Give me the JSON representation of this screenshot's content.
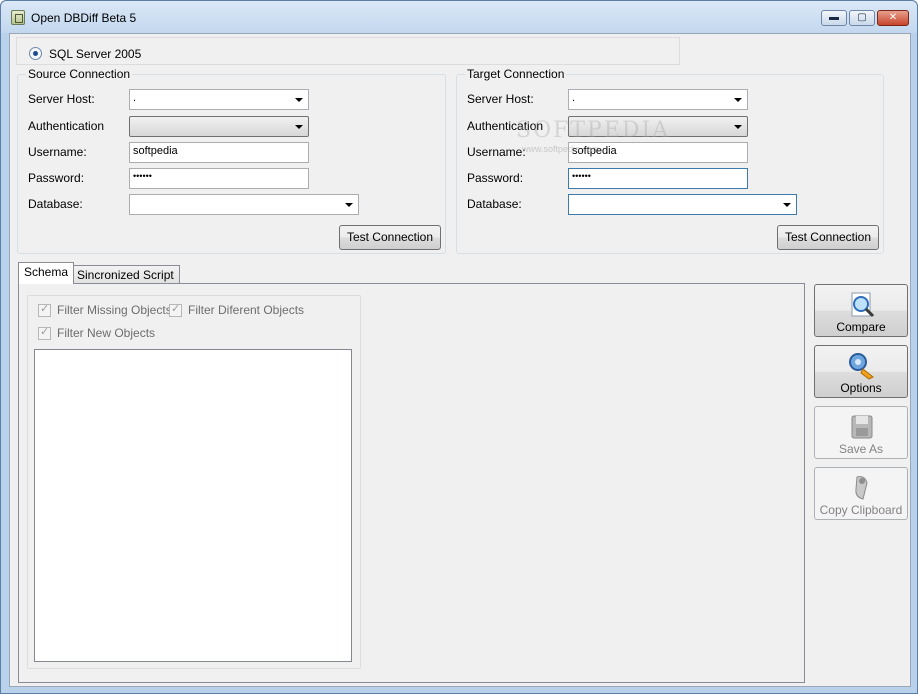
{
  "window": {
    "title": "Open DBDiff Beta 5",
    "controls": {
      "minimize": "▬",
      "maximize": "▢",
      "close": "✕"
    }
  },
  "provider": {
    "label": "SQL Server 2005",
    "selected": true
  },
  "source": {
    "title": "Source Connection",
    "server_host_label": "Server Host:",
    "server_host_value": ".",
    "authentication_label": "Authentication",
    "authentication_value": "",
    "username_label": "Username:",
    "username_value": "softpedia",
    "password_label": "Password:",
    "password_value": "••••••",
    "database_label": "Database:",
    "database_value": "",
    "test_button": "Test Connection"
  },
  "target": {
    "title": "Target Connection",
    "server_host_label": "Server Host:",
    "server_host_value": ".",
    "authentication_label": "Authentication",
    "authentication_value": "",
    "username_label": "Username:",
    "username_value": "softpedia",
    "password_label": "Password:",
    "password_value": "••••••",
    "database_label": "Database:",
    "database_value": "",
    "test_button": "Test Connection"
  },
  "tabs": [
    {
      "label": "Schema",
      "active": true
    },
    {
      "label": "Sincronized Script",
      "active": false
    }
  ],
  "filters": {
    "missing": {
      "label": "Filter Missing Objects",
      "checked": true,
      "enabled": false
    },
    "different": {
      "label": "Filter Diferent Objects",
      "checked": true,
      "enabled": false
    },
    "new": {
      "label": "Filter New Objects",
      "checked": true,
      "enabled": false
    }
  },
  "actions": {
    "compare": {
      "label": "Compare",
      "icon": "magnifier-document-icon",
      "enabled": true
    },
    "options": {
      "label": "Options",
      "icon": "gears-icon",
      "enabled": true
    },
    "save_as": {
      "label": "Save As",
      "icon": "floppy-disk-icon",
      "enabled": false
    },
    "copy_clipboard": {
      "label": "Copy Clipboard",
      "icon": "clipboard-icon",
      "enabled": false
    }
  },
  "watermark": {
    "text": "SOFTPEDIA",
    "sub": "www.softpedia.com"
  },
  "colors": {
    "title_bar": "#c2d7ee",
    "accent": "#1d4a8c",
    "close_button": "#c7442b"
  }
}
